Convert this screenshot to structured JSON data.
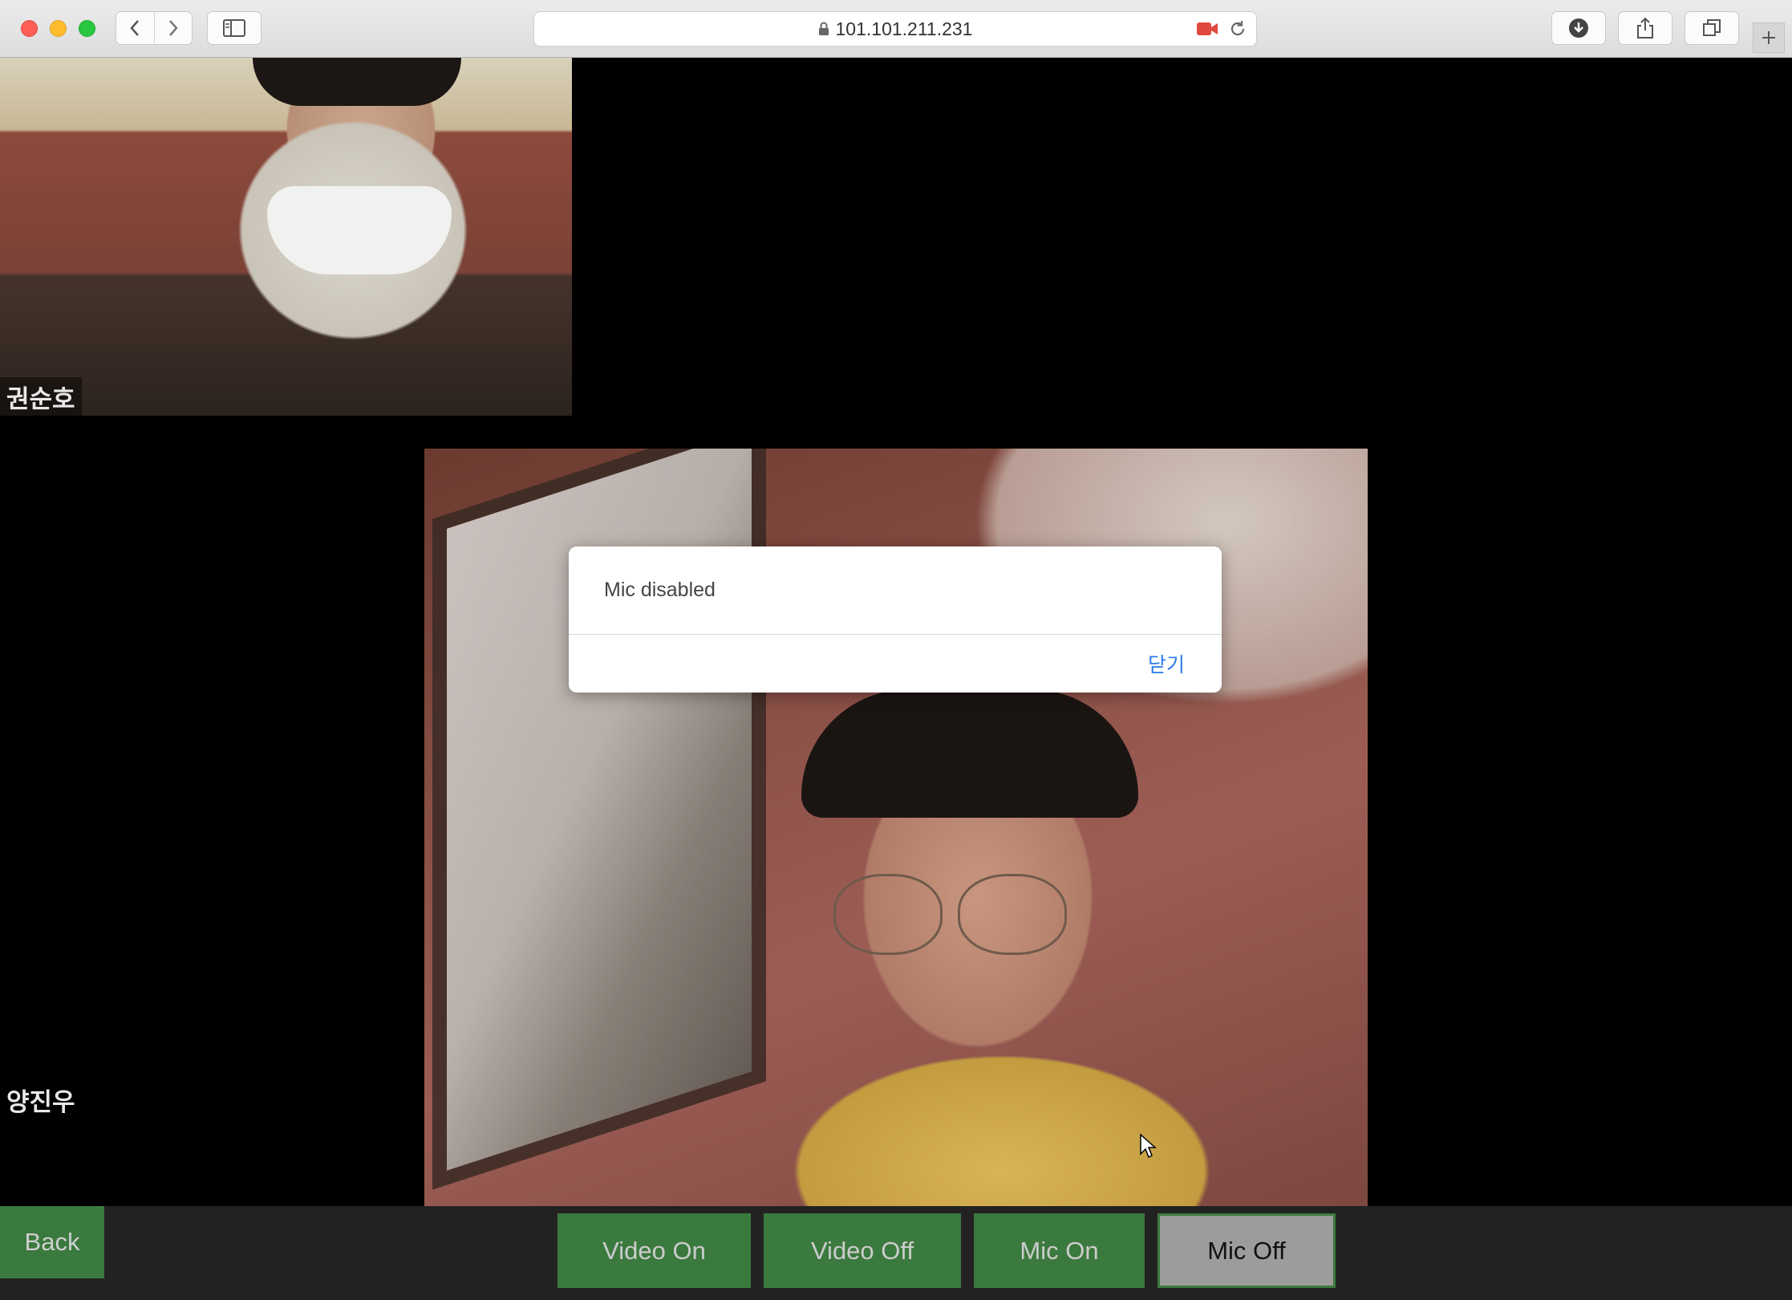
{
  "browser": {
    "address": "101.101.211.231",
    "icons": [
      "back-icon",
      "forward-icon",
      "sidebar-icon",
      "lock-icon",
      "camera-icon",
      "reload-icon",
      "download-icon",
      "share-icon",
      "tabs-icon",
      "plus-icon"
    ]
  },
  "participants": {
    "remote": {
      "name": "권순호"
    },
    "local": {
      "name": "양진우"
    }
  },
  "dialog": {
    "message": "Mic disabled",
    "close_label": "닫기"
  },
  "controls": {
    "back": "Back",
    "video_on": "Video On",
    "video_off": "Video Off",
    "mic_on": "Mic On",
    "mic_off": "Mic Off"
  },
  "colors": {
    "button_green": "#3b7a3e",
    "button_active_gray": "#9c9c9c",
    "dialog_link": "#2b7de9",
    "bar_background": "#222222"
  }
}
